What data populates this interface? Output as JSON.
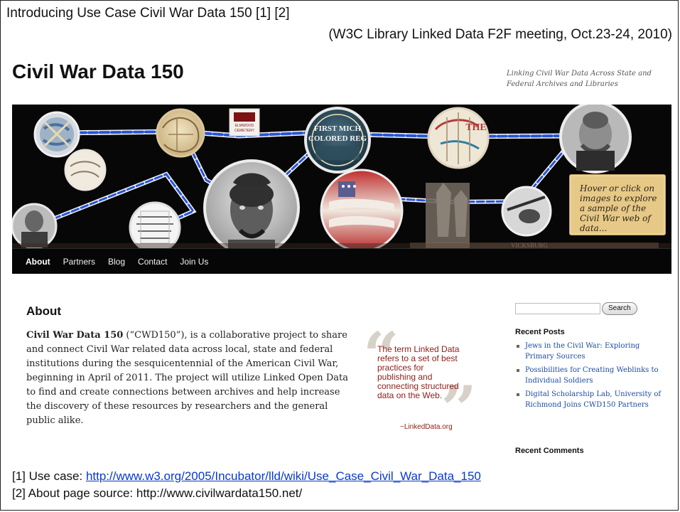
{
  "slide": {
    "title": "Introducing Use Case Civil War Data 150 [1] [2]",
    "subtitle": "(W3C Library Linked Data F2F meeting, Oct.23-24, 2010)"
  },
  "site": {
    "title": "Civil War Data 150",
    "tagline": "Linking Civil War Data Across State and Federal Archives and Libraries",
    "hero": {
      "overlay_text": "Hover or click on images to explore a sample of the Civil War web of data...",
      "colors": {
        "background": "#070707",
        "connector": "#2754d8",
        "accent": "#e7c987"
      },
      "visible_labels": {
        "cemetery_sign": "ELMWOOD CEMETERY",
        "badge": "FIRST MICH COLORED REG",
        "map_label": "THE",
        "banner_text": "VICKSBURG"
      }
    },
    "nav": [
      "About",
      "Partners",
      "Blog",
      "Contact",
      "Join Us"
    ],
    "main": {
      "heading": "About",
      "lead": "Civil War Data 150",
      "paragraph": " (“CWD150”), is a collaborative project to share and connect Civil War related data across local, state and federal institutions during the sesquicentennial of the American Civil War, beginning in April of 2011. The project will utilize Linked Open Data to find and create connections between archives and help increase the discovery of these resources by researchers and the general public alike."
    },
    "quote": {
      "open": "“",
      "text": "The term Linked Data refers to a set of best practices for publishing and connecting structured data on the Web.",
      "close": "”",
      "source": "~LinkedData.org"
    },
    "sidebar": {
      "search_button": "Search",
      "search_value": "",
      "recent_posts_title": "Recent Posts",
      "recent_posts": [
        "Jews in the Civil War: Exploring Primary Sources",
        "Possibilities for Creating Weblinks to Individual Soldiers",
        "Digital Scholarship Lab, University of Richmond Joins CWD150 Partners"
      ],
      "recent_comments_title": "Recent Comments"
    }
  },
  "references": [
    {
      "prefix": "[1] Use case: ",
      "link": "http://www.w3.org/2005/Incubator/lld/wiki/Use_Case_Civil_War_Data_150"
    },
    {
      "prefix": "[2] About page source: ",
      "text": "http://www.civilwardata150.net/"
    }
  ]
}
